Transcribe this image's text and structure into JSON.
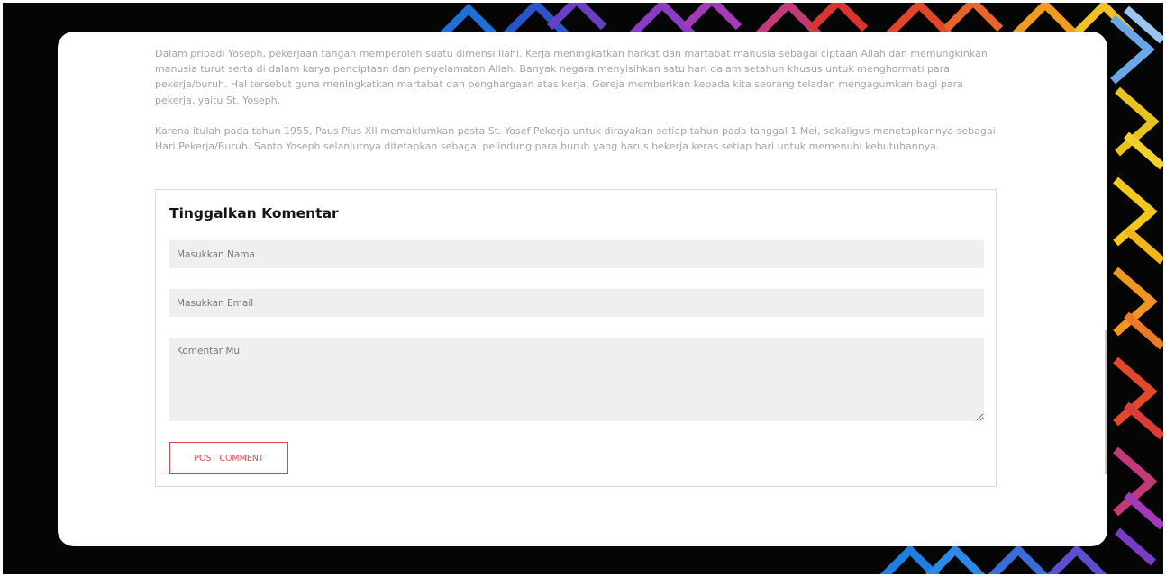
{
  "article": {
    "paragraphs": [
      "Dalam pribadi Yoseph, pekerjaan tangan memperoleh suatu dimensi Ilahi. Kerja meningkatkan harkat dan martabat manusia sebagai ciptaan Allah dan memungkinkan manusia turut serta di dalam karya penciptaan dan penyelamatan Allah. Banyak negara menyisihkan satu hari dalam setahun khusus untuk menghormati para pekerja/buruh. Hal tersebut guna meningkatkan martabat dan penghargaan atas kerja. Gereja memberikan kepada kita seorang teladan mengagumkan bagi para pekerja, yaitu St. Yoseph.",
      "Karena itulah pada tahun 1955, Paus Pius XII memaklumkan pesta St. Yosef Pekerja untuk dirayakan setiap tahun pada tanggal 1 Mei, sekaligus menetapkannya sebagai Hari Pekerja/Buruh. Santo Yoseph selanjutnya ditetapkan sebagai pelindung para buruh yang harus bekerja keras setiap hari untuk memenuhi kebutuhannya."
    ]
  },
  "comment_form": {
    "title": "Tinggalkan Komentar",
    "name_placeholder": "Masukkan Nama",
    "name_value": "",
    "email_placeholder": "Masukkan Email",
    "email_value": "",
    "comment_placeholder": "Komentar Mu",
    "comment_value": "",
    "submit_label": "POST COMMENT"
  },
  "colors": {
    "accent": "#e0474c",
    "field_bg": "#efefef",
    "text_muted": "#a5a5a5"
  }
}
